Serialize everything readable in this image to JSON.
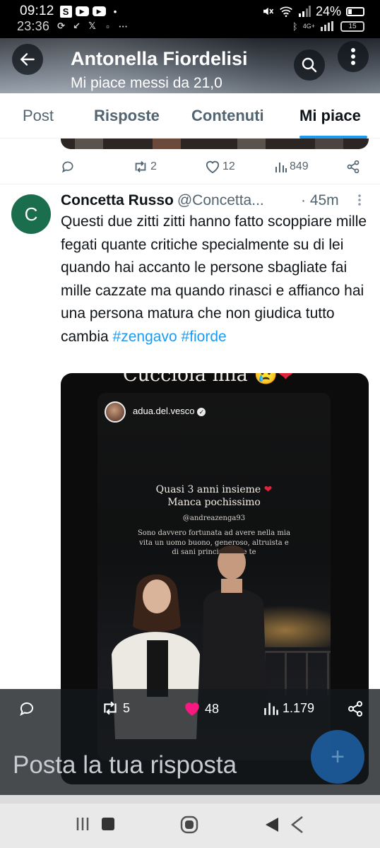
{
  "status_bar": {
    "time": "09:12",
    "time2": "23:36",
    "battery": "24%",
    "battery2": "15",
    "network2": "4G+"
  },
  "header": {
    "title": "Antonella Fiordelisi",
    "subtitle": "Mi piace messi da 21,0"
  },
  "tabs": [
    {
      "label": "Post"
    },
    {
      "label": "Risposte"
    },
    {
      "label": "Contenuti"
    },
    {
      "label": "Mi piace"
    }
  ],
  "prev_tweet": {
    "retweets": "2",
    "likes": "12",
    "views": "849"
  },
  "tweet": {
    "avatar_letter": "C",
    "author_name": "Concetta Russo",
    "handle": "@Concetta...",
    "time": "· 45m",
    "text": "Questi due zitti zitti hanno fatto scoppiare mille fegati quante critiche specialmente su di lei quando hai accanto le persone sbagliate fai mille cazzate ma quando rinasci e affianco hai una persona matura che non giudica tutto cambia",
    "hashtag1": "#zengavo",
    "hashtag2": "#fiorde",
    "image": {
      "top_text": "Cucciola mia",
      "story_user": "adua.del.vesco",
      "caption_line1": "Quasi 3 anni insieme",
      "caption_line2": "Manca pochissimo",
      "mention": "@andreazenga93",
      "caption_body": "Sono davvero fortunata ad avere nella mia vita un uomo buono, generoso, altruista e di sani principi come te"
    },
    "stats": {
      "retweets": "5",
      "likes": "48",
      "views": "1.179"
    }
  },
  "reply": {
    "placeholder": "Posta la tua risposta"
  },
  "colors": {
    "accent": "#1d9bf0",
    "like_active": "#f91880",
    "avatar_bg": "#1a6d4d"
  }
}
